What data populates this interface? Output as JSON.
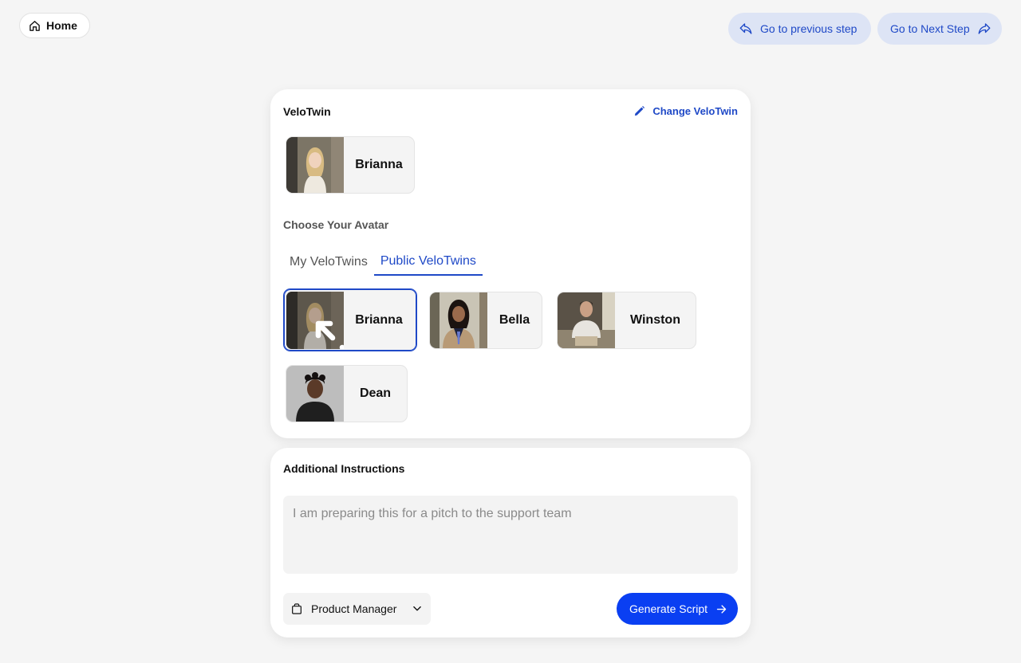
{
  "header": {
    "home_label": "Home",
    "prev_label": "Go to previous step",
    "next_label": "Go to Next Step"
  },
  "velotwin": {
    "title": "VeloTwin",
    "change_label": "Change VeloTwin",
    "current_name": "Brianna"
  },
  "avatars": {
    "section_label": "Choose Your Avatar",
    "tabs": [
      {
        "label": "My VeloTwins",
        "active": false
      },
      {
        "label": "Public VeloTwins",
        "active": true
      }
    ],
    "items": [
      {
        "name": "Brianna",
        "selected": true
      },
      {
        "name": "Bella",
        "selected": false
      },
      {
        "name": "Winston",
        "selected": false
      },
      {
        "name": "Dean",
        "selected": false
      }
    ]
  },
  "instructions": {
    "title": "Additional Instructions",
    "placeholder": "I am preparing this for a pitch to the support team",
    "value": "",
    "role_value": "Product Manager",
    "generate_label": "Generate Script"
  },
  "colors": {
    "accent": "#1f49c7",
    "primary_button": "#0a3ff2",
    "nav_button_bg": "#dde4f5"
  }
}
